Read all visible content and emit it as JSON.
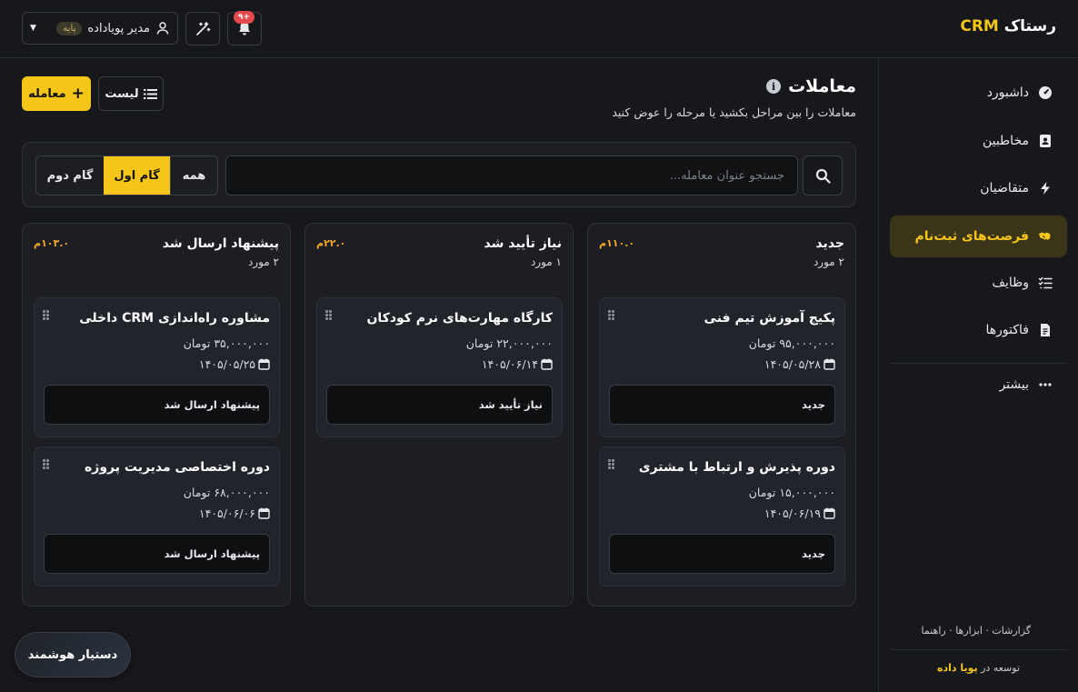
{
  "brand": {
    "name": "رستاک",
    "crm": "CRM"
  },
  "user": {
    "name": "مدیر پویاداده",
    "plan": "پایه"
  },
  "notifications": {
    "count": "+۹"
  },
  "sidebar": {
    "items": [
      {
        "label": "داشبورد",
        "icon": "dashboard-icon"
      },
      {
        "label": "مخاطبین",
        "icon": "contacts-icon"
      },
      {
        "label": "متقاضیان",
        "icon": "bolt-icon"
      },
      {
        "label": "فرصت‌های ثبت‌نام",
        "icon": "handshake-icon",
        "active": true
      },
      {
        "label": "وظایف",
        "icon": "tasks-icon"
      },
      {
        "label": "فاکتورها",
        "icon": "invoice-icon"
      },
      {
        "label": "بیشتر",
        "icon": "more-icon"
      }
    ],
    "footer_links": "گزارشات · ابزارها · راهنما",
    "credit_prefix": "توسعه در",
    "credit_brand": "پویا داده"
  },
  "page": {
    "title": "معاملات",
    "subtitle": "معاملات را بین مراحل بکشید یا مرحله را عوض کنید",
    "add_label": "معامله",
    "list_label": "لیست"
  },
  "filter": {
    "search_placeholder": "جستجو عنوان معامله...",
    "segments": [
      "همه",
      "گام اول",
      "گام دوم"
    ],
    "selected": "گام اول"
  },
  "columns": [
    {
      "title": "جدید",
      "count": "۲ مورد",
      "total": "۱۱۰.۰م",
      "cards": [
        {
          "title": "پکیج آموزش تیم فنی",
          "price": "۹۵,۰۰۰,۰۰۰ تومان",
          "date": "۱۴۰۵/۰۵/۲۸",
          "stage": "جدید"
        },
        {
          "title": "دوره پذیرش و ارتباط با مشتری",
          "price": "۱۵,۰۰۰,۰۰۰ تومان",
          "date": "۱۴۰۵/۰۶/۱۹",
          "stage": "جدید"
        }
      ]
    },
    {
      "title": "نیاز تأیید شد",
      "count": "۱ مورد",
      "total": "۲۲.۰م",
      "cards": [
        {
          "title": "کارگاه مهارت‌های نرم کودکان",
          "price": "۲۲,۰۰۰,۰۰۰ تومان",
          "date": "۱۴۰۵/۰۶/۱۴",
          "stage": "نیاز تأیید شد"
        }
      ]
    },
    {
      "title": "پیشنهاد ارسال شد",
      "count": "۲ مورد",
      "total": "۱۰۳.۰م",
      "cards": [
        {
          "title": "مشاوره راه‌اندازی CRM داخلی",
          "price": "۳۵,۰۰۰,۰۰۰ تومان",
          "date": "۱۴۰۵/۰۵/۲۵",
          "stage": "پیشنهاد ارسال شد"
        },
        {
          "title": "دوره اختصاصی مدیریت پروژه",
          "price": "۶۸,۰۰۰,۰۰۰ تومان",
          "date": "۱۴۰۵/۰۶/۰۶",
          "stage": "پیشنهاد ارسال شد"
        }
      ]
    }
  ],
  "assistant": {
    "label": "دستیار هوشمند"
  },
  "colors": {
    "accent": "#f5c518",
    "background": "#17181c",
    "panel": "#1c1e24",
    "card": "#22242b",
    "total": "#f5a623",
    "badge": "#e5484d"
  }
}
